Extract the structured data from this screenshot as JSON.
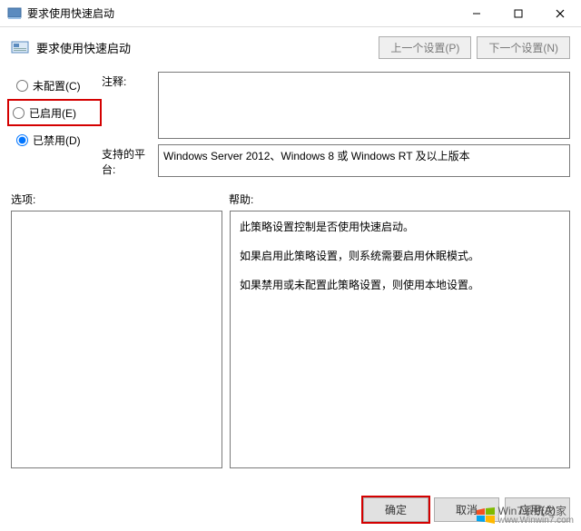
{
  "titlebar": {
    "title": "要求使用快速启动"
  },
  "header": {
    "title": "要求使用快速启动",
    "prev_btn": "上一个设置(P)",
    "next_btn": "下一个设置(N)"
  },
  "radios": {
    "not_configured": "未配置(C)",
    "enabled": "已启用(E)",
    "disabled": "已禁用(D)"
  },
  "labels": {
    "comment": "注释:",
    "platform": "支持的平台:",
    "options": "选项:",
    "help": "帮助:"
  },
  "platform_text": "Windows Server 2012、Windows 8 或 Windows RT 及以上版本",
  "help_paragraphs": [
    "此策略设置控制是否使用快速启动。",
    "如果启用此策略设置，则系统需要启用休眠模式。",
    "如果禁用或未配置此策略设置，则使用本地设置。"
  ],
  "footer": {
    "ok": "确定",
    "cancel": "取消",
    "apply": "应用(A)"
  },
  "watermark": {
    "text1": "Win7系统之家",
    "text2": "www.Winwin7.com"
  }
}
